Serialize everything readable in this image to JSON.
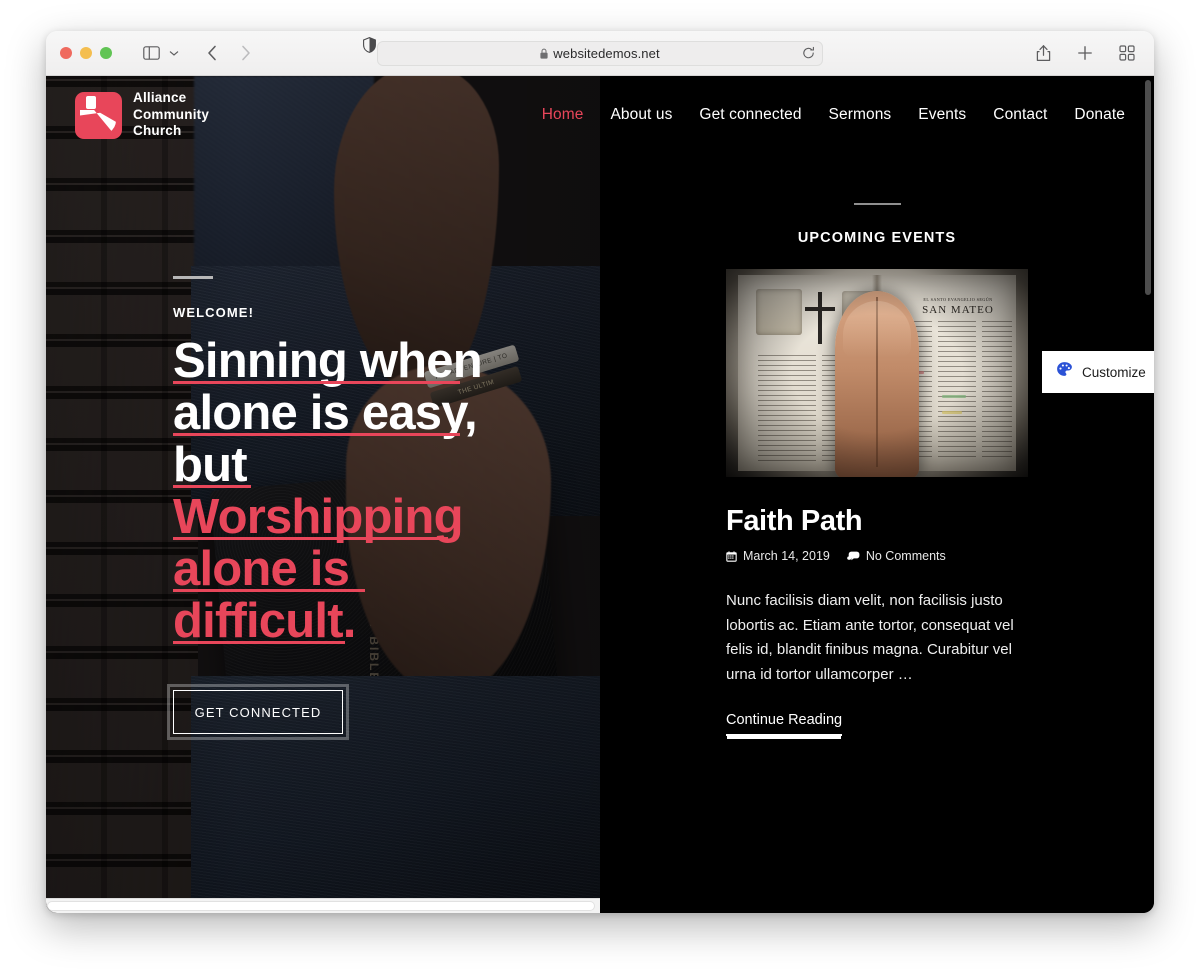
{
  "browser": {
    "traffic_lights": [
      "close",
      "minimize",
      "zoom"
    ],
    "sidebar_icon": "sidebar-icon",
    "chevron_icon": "chevron-down-icon",
    "back_icon": "back-chevron-icon",
    "forward_icon": "forward-chevron-icon",
    "shield_icon": "privacy-shield-icon",
    "address": {
      "lock_icon": "lock-icon",
      "url": "websitedemos.net",
      "reload_icon": "reload-icon"
    },
    "actions": {
      "share_icon": "share-icon",
      "new_tab_icon": "plus-icon",
      "tab_overview_icon": "tab-overview-icon"
    }
  },
  "site": {
    "brand": {
      "logo_icon": "alliance-church-logo-icon",
      "name_line1": "Alliance",
      "name_line2": "Community",
      "name_line3": "Church",
      "accent_color": "#e8465a"
    },
    "nav": [
      {
        "label": "Home",
        "active": true
      },
      {
        "label": "About us",
        "active": false
      },
      {
        "label": "Get connected",
        "active": false
      },
      {
        "label": "Sermons",
        "active": false
      },
      {
        "label": "Events",
        "active": false
      },
      {
        "label": "Contact",
        "active": false
      },
      {
        "label": "Donate",
        "active": false
      }
    ],
    "hero": {
      "eyebrow": "WELCOME!",
      "title_lines": [
        {
          "text": "Sinning when",
          "color": "white"
        },
        {
          "text": "alone is easy,",
          "color": "white"
        },
        {
          "text": "but",
          "color": "white"
        },
        {
          "text": "Worshipping",
          "color": "red"
        },
        {
          "text": "alone is",
          "color": "red"
        },
        {
          "text": "difficult.",
          "color": "red"
        }
      ],
      "cta_label": "GET CONNECTED",
      "background_alt": "man holding a Holy Bible against a brick wall"
    },
    "events": {
      "section_title": "UPCOMING EVENTS",
      "thumb_alt": "praying hands over an open Bible",
      "thumb_text_heading": "SAN MATEO",
      "thumb_text_kicker": "EL SANTO EVANGELIO SEGÚN",
      "post": {
        "title": "Faith Path",
        "date_icon": "calendar-icon",
        "date": "March 14, 2019",
        "comments_icon": "comment-icon",
        "comments": "No Comments",
        "excerpt": "Nunc facilisis diam velit, non facilisis justo lobortis ac. Etiam ante tortor, consequat vel felis id, blandit finibus magna. Curabitur vel urna id tortor ullamcorper …",
        "continue_label": "Continue Reading"
      }
    }
  },
  "customize": {
    "icon": "palette-icon",
    "label": "Customize",
    "icon_color": "#2b52d6"
  }
}
